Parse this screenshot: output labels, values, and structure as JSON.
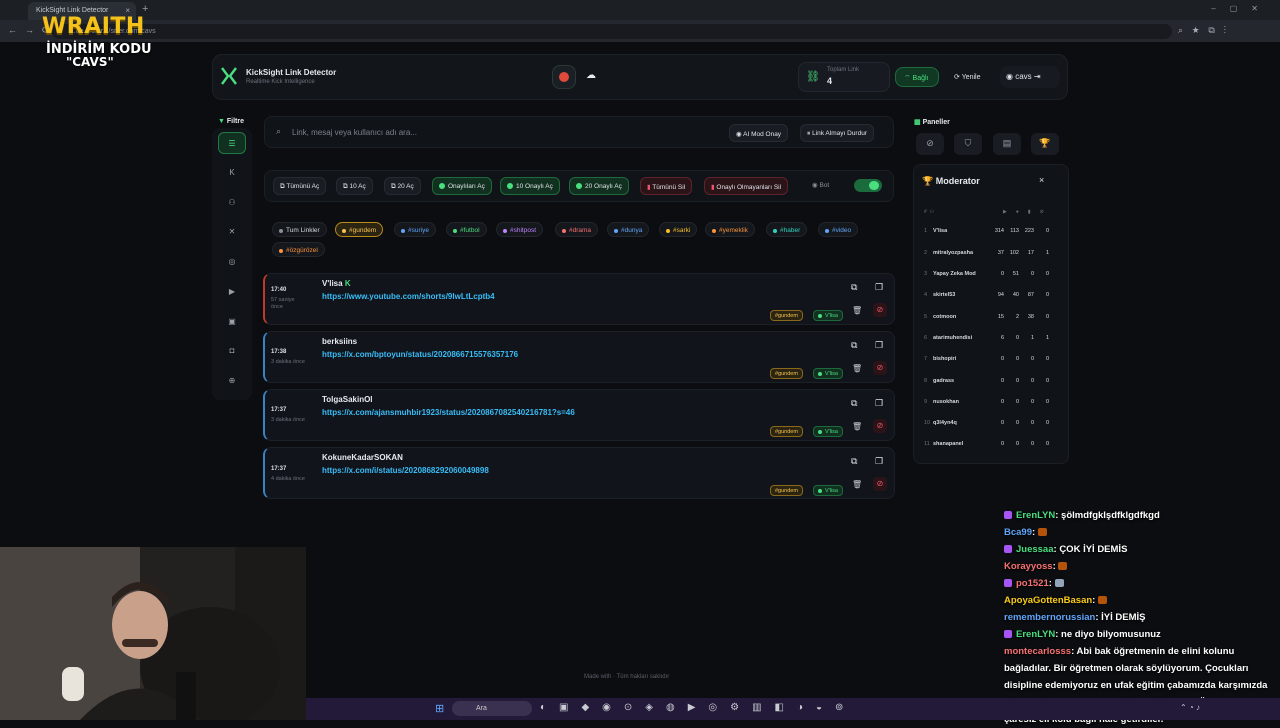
{
  "browser": {
    "tab_title": "KickSight Link Detector",
    "url": "...de.../ctor.../srfer.com/cavs",
    "tab_close": "×",
    "newtab": "+"
  },
  "overlay": {
    "brand": "WRAITH",
    "line1": "İNDİRİM KODU",
    "line2": "\"CAVS\""
  },
  "header": {
    "title": "KickSight Link Detector",
    "subtitle": "Realtime Kick Intelligence",
    "stat_label": "Toplam Link",
    "stat_value": "4",
    "connected": "Bağlı",
    "refresh": "Yenile",
    "user": "cavs"
  },
  "sidebar": {
    "title": "Filtre",
    "items": [
      "list",
      "kick",
      "users",
      "x",
      "instagram",
      "youtube",
      "video",
      "camera",
      "globe"
    ]
  },
  "search": {
    "placeholder": "Link, mesaj veya kullanıcı adı ara...",
    "ai_mod": "AI Mod Onay",
    "stop": "Link Almayı Durdur"
  },
  "actions": {
    "open_all": "Tümünü Aç",
    "open10": "10 Aç",
    "open20": "20 Aç",
    "open_approved": "Onaylıları Aç",
    "open10_approved": "10 Onaylı Aç",
    "open20_approved": "20 Onaylı Aç",
    "delete_all": "Tümünü Sil",
    "delete_unapproved": "Onaylı Olmayanları Sil",
    "bot": "Bot"
  },
  "tags": [
    {
      "label": "Tum Linkler",
      "color": "#c7cad0"
    },
    {
      "label": "#gundem",
      "color": "#f5c451"
    },
    {
      "label": "#suriye",
      "color": "#60a5fa"
    },
    {
      "label": "#futbol",
      "color": "#4ade80"
    },
    {
      "label": "#shitpost",
      "color": "#c084fc"
    },
    {
      "label": "#drama",
      "color": "#f87171"
    },
    {
      "label": "#dunya",
      "color": "#60a5fa"
    },
    {
      "label": "#sarki",
      "color": "#fbbf24"
    },
    {
      "label": "#yemeklik",
      "color": "#fb923c"
    },
    {
      "label": "#haber",
      "color": "#2dd4bf"
    },
    {
      "label": "#video",
      "color": "#60a5fa"
    },
    {
      "label": "#özgürözel",
      "color": "#fb923c"
    }
  ],
  "links": [
    {
      "time": "17:40",
      "ago1": "57 saniye",
      "ago2": "önce",
      "user": "V'lisa",
      "url": "https://www.youtube.com/shorts/9lwLtLcptb4",
      "tag": "#gundem",
      "approver": "V'lisa"
    },
    {
      "time": "17:38",
      "ago1": "3 dakika önce",
      "ago2": "",
      "user": "berksiins",
      "url": "https://x.com/bptoyun/status/2020866715576357176",
      "tag": "#gundem",
      "approver": "V'lisa"
    },
    {
      "time": "17:37",
      "ago1": "3 dakika önce",
      "ago2": "",
      "user": "TolgaSakinOl",
      "url": "https://x.com/ajansmuhbir1923/status/2020867082540216781?s=46",
      "tag": "#gundem",
      "approver": "V'lisa"
    },
    {
      "time": "17:37",
      "ago1": "4 dakika önce",
      "ago2": "",
      "user": "KokuneKadarSOKAN",
      "url": "https://x.com/i/status/2020868292060049898",
      "tag": "#gundem",
      "approver": "V'lisa"
    }
  ],
  "panels": {
    "title": "Paneller",
    "moderator_title": "Moderator",
    "close": "×",
    "rows": [
      {
        "rank": "1",
        "name": "V'lisa",
        "a": "314",
        "b": "113",
        "c": "223",
        "d": "0"
      },
      {
        "rank": "2",
        "name": "mitralyozpasha",
        "a": "37",
        "b": "102",
        "c": "17",
        "d": "1"
      },
      {
        "rank": "3",
        "name": "Yapay Zeka Mod",
        "a": "0",
        "b": "51",
        "c": "0",
        "d": "0"
      },
      {
        "rank": "4",
        "name": "skirtel53",
        "a": "94",
        "b": "40",
        "c": "87",
        "d": "0"
      },
      {
        "rank": "5",
        "name": "cotmoon",
        "a": "15",
        "b": "2",
        "c": "38",
        "d": "0"
      },
      {
        "rank": "6",
        "name": "atarimuhendisi",
        "a": "6",
        "b": "0",
        "c": "1",
        "d": "1"
      },
      {
        "rank": "7",
        "name": "bishopiri",
        "a": "0",
        "b": "0",
        "c": "0",
        "d": "0"
      },
      {
        "rank": "8",
        "name": "gadrass",
        "a": "0",
        "b": "0",
        "c": "0",
        "d": "0"
      },
      {
        "rank": "9",
        "name": "nusokhan",
        "a": "0",
        "b": "0",
        "c": "0",
        "d": "0"
      },
      {
        "rank": "10",
        "name": "q3l4yn4q",
        "a": "0",
        "b": "0",
        "c": "0",
        "d": "0"
      },
      {
        "rank": "11",
        "name": "shanapanel",
        "a": "0",
        "b": "0",
        "c": "0",
        "d": "0"
      }
    ]
  },
  "footer": "Made with  · Tüm hakları saklıdır",
  "chat": [
    {
      "name": "ErenLYN",
      "color": "#4ade80",
      "badge": true,
      "text": ": şölmdfgklşdfklgdfkgd"
    },
    {
      "name": "Bca99",
      "color": "#60a5fa",
      "badge": false,
      "text": ":"
    },
    {
      "name": "Juessaa",
      "color": "#4ade80",
      "badge": true,
      "text": ": ÇOK İYİ DEMİS"
    },
    {
      "name": "Korayyoss",
      "color": "#f87171",
      "badge": false,
      "text": ":"
    },
    {
      "name": "po1521",
      "color": "#f87171",
      "badge": true,
      "text": ":"
    },
    {
      "name": "ApoyaGottenBasan",
      "color": "#facc15",
      "badge": false,
      "text": ":"
    },
    {
      "name": "remembernorussian",
      "color": "#60a5fa",
      "badge": false,
      "text": ": İYİ DEMİŞ"
    },
    {
      "name": "ErenLYN",
      "color": "#4ade80",
      "badge": true,
      "text": ": ne diyo bilyomusunuz"
    },
    {
      "name": "montecarlosss",
      "color": "#f87171",
      "badge": false,
      "text": ": Abi bak öğretmenin de elini kolunu bağladılar. Bir öğretmen olarak söylüyorum. Çocukları disipline edemiyoruz en ufak eğitim çabamızda karşımızda şikayete kaygıya gelmiş velileri görüyoruz. Öğretmeni çaresiz eli kolu bağlı hale getirdiler."
    }
  ],
  "taskbar": {
    "search": "Ara"
  }
}
